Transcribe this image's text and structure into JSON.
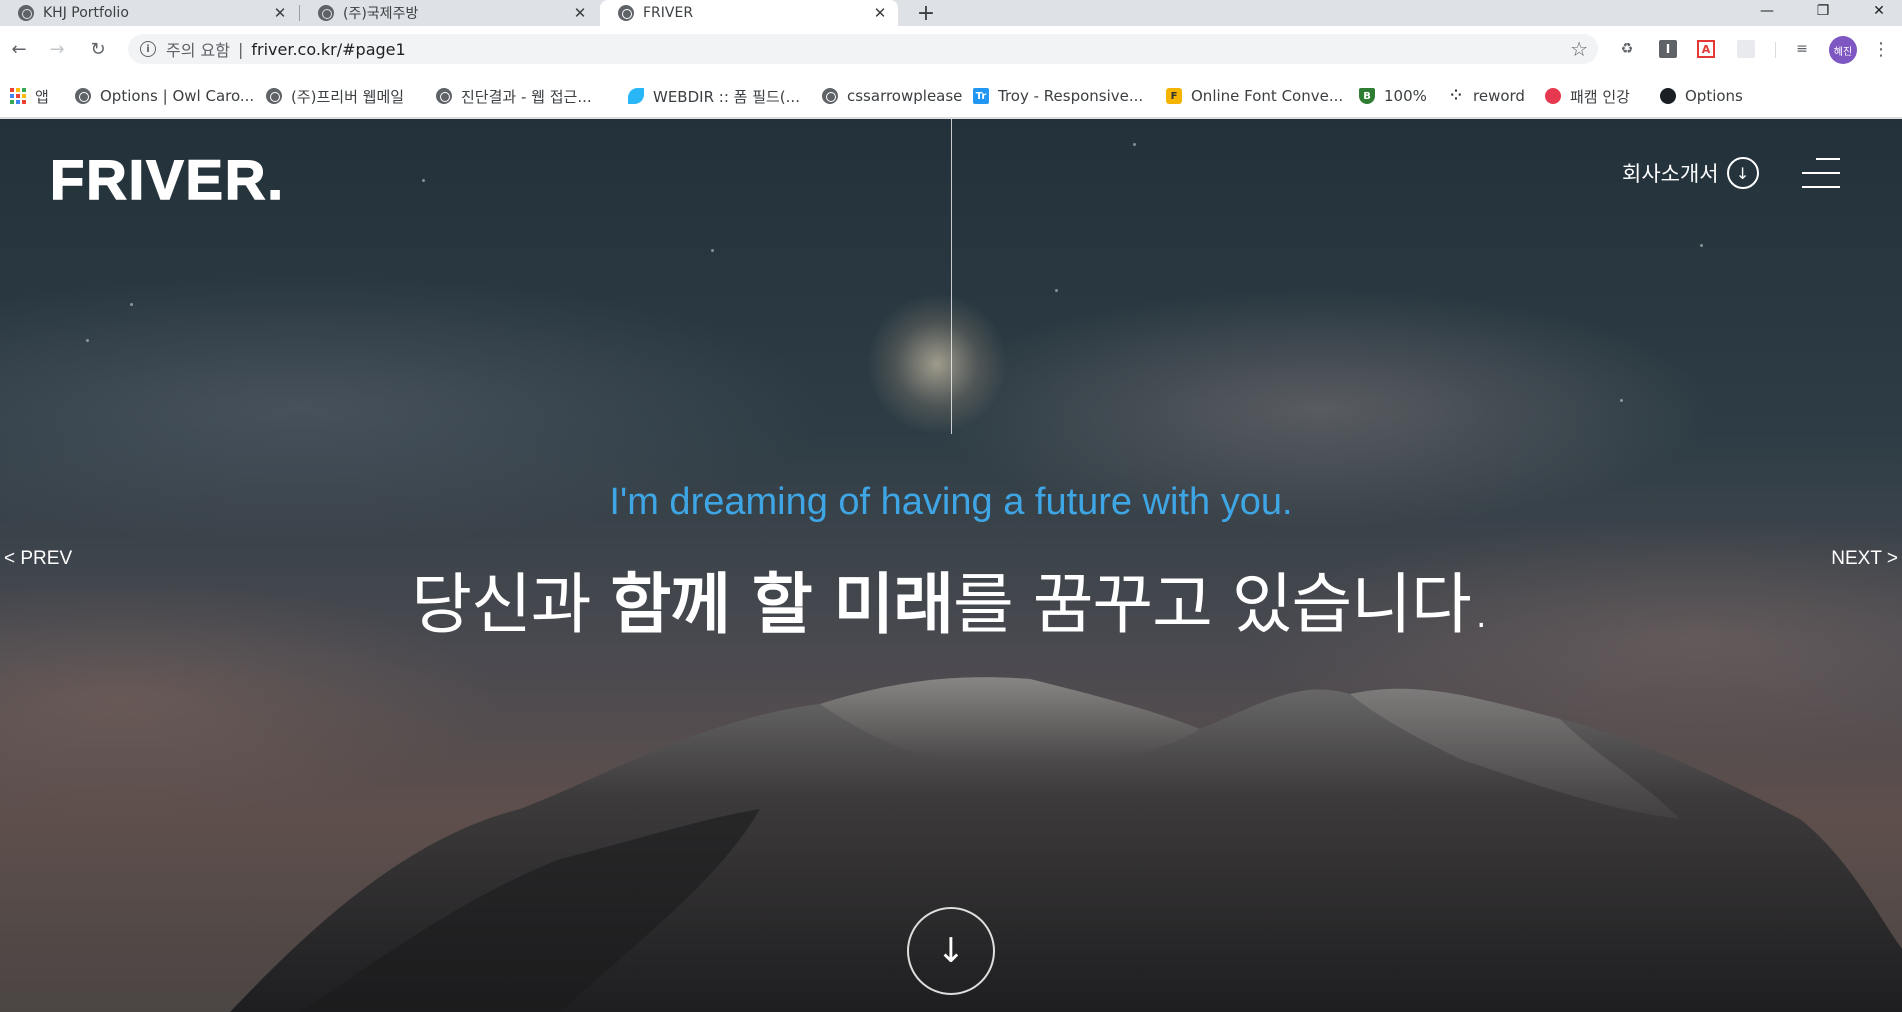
{
  "browser": {
    "tabs": [
      {
        "title": "KHJ Portfolio",
        "active": false
      },
      {
        "title": "(주)국제주방",
        "active": false
      },
      {
        "title": "FRIVER",
        "active": true
      }
    ],
    "new_tab": "+",
    "close_glyph": "✕",
    "window_controls": {
      "minimize": "—",
      "restore": "❐",
      "close": "✕"
    }
  },
  "toolbar": {
    "back": "←",
    "forward": "→",
    "reload": "↻",
    "security_icon": "i",
    "security_label": "주의 요함",
    "separator": "|",
    "url": "friver.co.kr/#page1",
    "bookmark_star": "☆",
    "avatar_text": "혜진",
    "menu": "⋮"
  },
  "bookmarks": [
    {
      "label": "앱",
      "icon": "apps-icon"
    },
    {
      "label": "Options | Owl Caro...",
      "icon": "globe-icon"
    },
    {
      "label": "(주)프리버 웹메일",
      "icon": "globe-icon"
    },
    {
      "label": "진단결과 - 웹 접근...",
      "icon": "globe-icon"
    },
    {
      "label": "WEBDIR :: 폼 필드(...",
      "icon": "leaf-icon"
    },
    {
      "label": "cssarrowplease",
      "icon": "globe-icon"
    },
    {
      "label": "Troy - Responsive...",
      "icon": "tr-icon"
    },
    {
      "label": "Online Font Conve...",
      "icon": "font-icon"
    },
    {
      "label": "100%",
      "icon": "shield-icon"
    },
    {
      "label": "reword",
      "icon": "dots-icon"
    },
    {
      "label": "패캠 인강",
      "icon": "fastcampus-icon"
    },
    {
      "label": "Options",
      "icon": "github-icon"
    }
  ],
  "page": {
    "logo": "FRIVER.",
    "company_intro": "회사소개서",
    "download_glyph": "↓",
    "prev": "< PREV",
    "next": "NEXT >",
    "subtitle": "I'm dreaming of having a future with you.",
    "headline": {
      "part1": "당신과 ",
      "bold1": "함께 할 미래",
      "part2": "를 꿈꾸고 있습니다."
    },
    "scroll_glyph": "↓",
    "colors": {
      "subtitle": "#3ea6e5",
      "text": "#ffffff",
      "avatar": "#7e57c2"
    }
  }
}
